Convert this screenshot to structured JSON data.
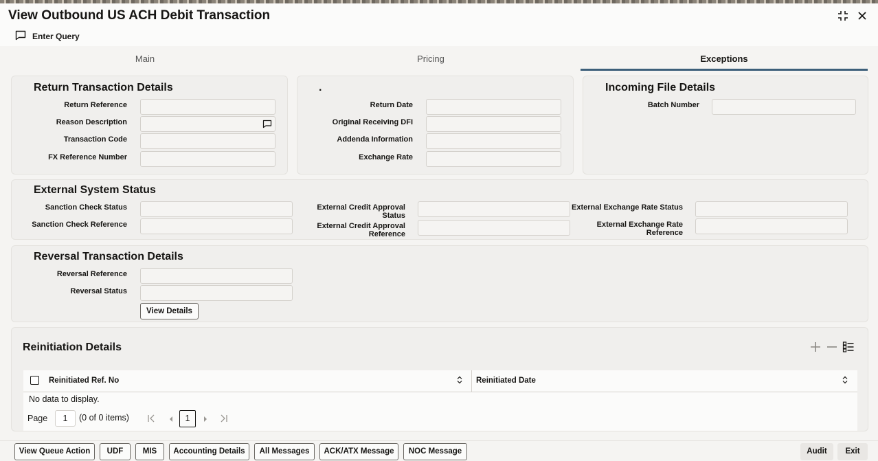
{
  "window": {
    "title": "View Outbound US ACH Debit Transaction"
  },
  "toolbar": {
    "enter_query": "Enter Query"
  },
  "tabs": [
    {
      "label": "Main"
    },
    {
      "label": "Pricing"
    },
    {
      "label": "Exceptions",
      "active": true
    }
  ],
  "return_transaction": {
    "title": "Return Transaction Details",
    "fields": {
      "return_reference": "Return Reference",
      "reason_description": "Reason Description",
      "transaction_code": "Transaction Code",
      "fx_reference_number": "FX Reference Number"
    }
  },
  "middle_block": {
    "title": ".",
    "fields": {
      "return_date": "Return Date",
      "original_receiving_dfi": "Original Receiving DFI",
      "addenda_information": "Addenda Information",
      "exchange_rate": "Exchange Rate"
    }
  },
  "incoming_file": {
    "title": "Incoming File Details",
    "fields": {
      "batch_number": "Batch Number"
    }
  },
  "external_status": {
    "title": "External System Status",
    "fields": {
      "sanction_check_status": "Sanction Check Status",
      "sanction_check_reference": "Sanction Check Reference",
      "ext_credit_status_1": "External Credit Approval",
      "ext_credit_status_2": "Status",
      "ext_credit_ref_1": "External Credit Approval",
      "ext_credit_ref_2": "Reference",
      "ext_fx_status": "External Exchange Rate Status",
      "ext_fx_ref_1": "External Exchange Rate",
      "ext_fx_ref_2": "Reference"
    }
  },
  "reversal": {
    "title": "Reversal Transaction Details",
    "fields": {
      "reversal_reference": "Reversal Reference",
      "reversal_status": "Reversal Status"
    },
    "view_details": "View Details"
  },
  "reinitiation": {
    "title": "Reinitiation Details",
    "columns": [
      "Reinitiated Ref. No",
      "Reinitiated Date"
    ],
    "empty": "No data to display.",
    "pager": {
      "page_label": "Page",
      "page_value": "1",
      "items": "(0 of 0 items)",
      "current": "1"
    }
  },
  "footer": {
    "buttons": [
      "View Queue Action",
      "UDF",
      "MIS",
      "Accounting Details",
      "All Messages",
      "ACK/ATX Message",
      "NOC Message"
    ],
    "right_buttons": [
      "Audit",
      "Exit"
    ]
  },
  "colors": {
    "accent": "#3d5f7a",
    "panel": "#f0efed",
    "background": "#f5f4f2"
  },
  "icons": [
    "comment-icon",
    "minimize-icon",
    "close-icon",
    "add-icon",
    "remove-icon",
    "column-manage-icon",
    "sort-icon",
    "first-page-icon",
    "prev-page-icon",
    "next-page-icon",
    "last-page-icon"
  ]
}
